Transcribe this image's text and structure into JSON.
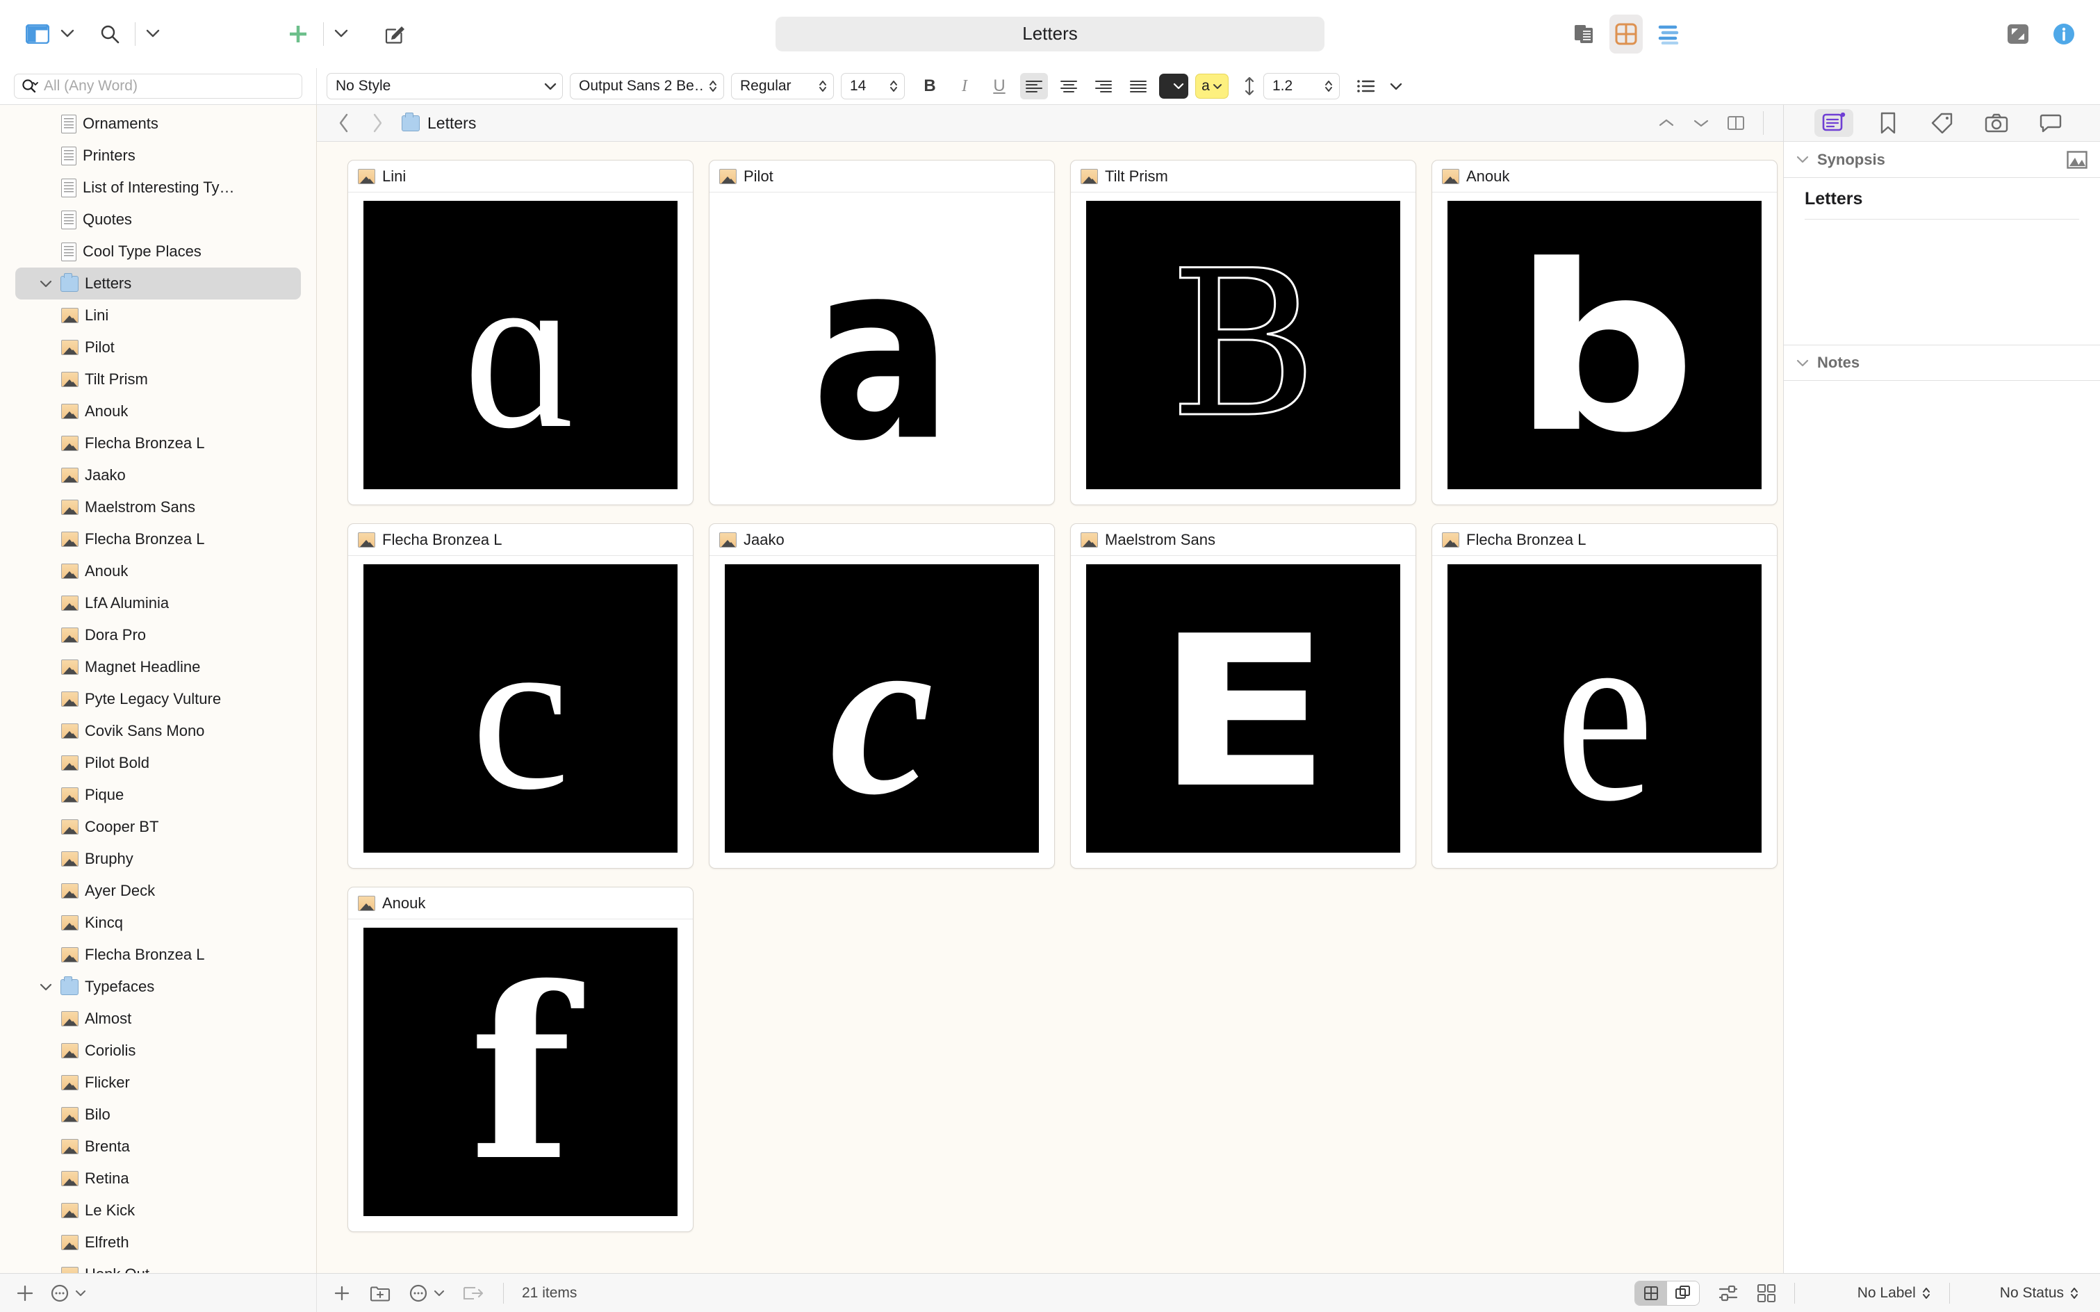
{
  "window": {
    "title": "Letters"
  },
  "toolbar": {
    "view_toggle": "sidebar-toggle",
    "search": "search",
    "add": "add",
    "compose": "compose",
    "copyholder": "copyholder",
    "corkboard": "corkboard",
    "outliner": "outliner",
    "composition_mode": "composition-mode",
    "inspector_toggle": "inspector"
  },
  "search": {
    "placeholder": "All (Any Word)"
  },
  "format_bar": {
    "style": "No Style",
    "font": "Output Sans 2 Be…",
    "weight": "Regular",
    "size": "14",
    "bold": "B",
    "italic": "I",
    "underline": "U",
    "text_color": "#2b2b2b",
    "highlight_color": "#fdf07f",
    "highlight_label": "a",
    "line_spacing": "1.2"
  },
  "binder": {
    "items": [
      {
        "label": "Ornaments",
        "icon": "document-icon",
        "indent": 1,
        "type": "doc"
      },
      {
        "label": "Printers",
        "icon": "document-icon",
        "indent": 1,
        "type": "doc"
      },
      {
        "label": "List of Interesting Ty…",
        "icon": "document-icon",
        "indent": 1,
        "type": "doc"
      },
      {
        "label": "Quotes",
        "icon": "document-icon",
        "indent": 1,
        "type": "doc"
      },
      {
        "label": "Cool Type Places",
        "icon": "document-icon",
        "indent": 1,
        "type": "doc"
      },
      {
        "label": "Letters",
        "icon": "folder-icon",
        "indent": 0,
        "type": "folder",
        "selected": true,
        "expanded": true
      },
      {
        "label": "Lini",
        "icon": "image-icon",
        "indent": 1,
        "type": "image"
      },
      {
        "label": "Pilot",
        "icon": "image-icon",
        "indent": 1,
        "type": "image"
      },
      {
        "label": "Tilt Prism",
        "icon": "image-icon",
        "indent": 1,
        "type": "image"
      },
      {
        "label": "Anouk",
        "icon": "image-icon",
        "indent": 1,
        "type": "image"
      },
      {
        "label": "Flecha Bronzea L",
        "icon": "image-icon",
        "indent": 1,
        "type": "image"
      },
      {
        "label": "Jaako",
        "icon": "image-icon",
        "indent": 1,
        "type": "image"
      },
      {
        "label": "Maelstrom Sans",
        "icon": "image-icon",
        "indent": 1,
        "type": "image"
      },
      {
        "label": "Flecha Bronzea L",
        "icon": "image-icon",
        "indent": 1,
        "type": "image"
      },
      {
        "label": "Anouk",
        "icon": "image-icon",
        "indent": 1,
        "type": "image"
      },
      {
        "label": "LfA Aluminia",
        "icon": "image-icon",
        "indent": 1,
        "type": "image"
      },
      {
        "label": "Dora Pro",
        "icon": "image-icon",
        "indent": 1,
        "type": "image"
      },
      {
        "label": "Magnet Headline",
        "icon": "image-icon",
        "indent": 1,
        "type": "image"
      },
      {
        "label": "Pyte Legacy Vulture",
        "icon": "image-icon",
        "indent": 1,
        "type": "image"
      },
      {
        "label": "Covik Sans Mono",
        "icon": "image-icon",
        "indent": 1,
        "type": "image"
      },
      {
        "label": "Pilot Bold",
        "icon": "image-icon",
        "indent": 1,
        "type": "image"
      },
      {
        "label": "Pique",
        "icon": "image-icon",
        "indent": 1,
        "type": "image"
      },
      {
        "label": "Cooper BT",
        "icon": "image-icon",
        "indent": 1,
        "type": "image"
      },
      {
        "label": "Bruphy",
        "icon": "image-icon",
        "indent": 1,
        "type": "image"
      },
      {
        "label": "Ayer Deck",
        "icon": "image-icon",
        "indent": 1,
        "type": "image"
      },
      {
        "label": "Kincq",
        "icon": "image-icon",
        "indent": 1,
        "type": "image"
      },
      {
        "label": "Flecha Bronzea L",
        "icon": "image-icon",
        "indent": 1,
        "type": "image"
      },
      {
        "label": "Typefaces",
        "icon": "folder-icon",
        "indent": 0,
        "type": "folder",
        "expanded": true
      },
      {
        "label": "Almost",
        "icon": "image-icon",
        "indent": 1,
        "type": "image"
      },
      {
        "label": "Coriolis",
        "icon": "image-icon",
        "indent": 1,
        "type": "image"
      },
      {
        "label": "Flicker",
        "icon": "image-icon",
        "indent": 1,
        "type": "image"
      },
      {
        "label": "Bilo",
        "icon": "image-icon",
        "indent": 1,
        "type": "image"
      },
      {
        "label": "Brenta",
        "icon": "image-icon",
        "indent": 1,
        "type": "image"
      },
      {
        "label": "Retina",
        "icon": "image-icon",
        "indent": 1,
        "type": "image"
      },
      {
        "label": "Le Kick",
        "icon": "image-icon",
        "indent": 1,
        "type": "image"
      },
      {
        "label": "Elfreth",
        "icon": "image-icon",
        "indent": 1,
        "type": "image"
      },
      {
        "label": "Henk Out",
        "icon": "image-icon",
        "indent": 1,
        "type": "image"
      }
    ]
  },
  "editor": {
    "breadcrumb_title": "Letters",
    "breadcrumb_icon": "folder-icon",
    "cards": [
      {
        "title": "Lini",
        "glyph": "ɑ",
        "style": "lini",
        "bg": "#000000",
        "fg": "#ffffff"
      },
      {
        "title": "Pilot",
        "glyph": "a",
        "style": "pilot",
        "bg": "#ffffff",
        "fg": "#000000"
      },
      {
        "title": "Tilt Prism",
        "glyph": "B",
        "style": "prism",
        "bg": "#000000",
        "fg": "#ffffff"
      },
      {
        "title": "Anouk",
        "glyph": "b",
        "style": "anouk",
        "bg": "#000000",
        "fg": "#ffffff"
      },
      {
        "title": "Flecha Bronzea L",
        "glyph": "c",
        "style": "flecha",
        "bg": "#000000",
        "fg": "#ffffff"
      },
      {
        "title": "Jaako",
        "glyph": "c",
        "style": "jaako",
        "bg": "#000000",
        "fg": "#ffffff"
      },
      {
        "title": "Maelstrom Sans",
        "glyph": "E",
        "style": "maelstrom",
        "bg": "#000000",
        "fg": "#ffffff"
      },
      {
        "title": "Flecha Bronzea L",
        "glyph": "e",
        "style": "flechae",
        "bg": "#000000",
        "fg": "#ffffff"
      },
      {
        "title": "Anouk",
        "glyph": "f",
        "style": "anoukf",
        "bg": "#000000",
        "fg": "#ffffff"
      }
    ]
  },
  "inspector": {
    "tabs": [
      {
        "name": "notes-tab",
        "icon": "note-card-icon",
        "selected": true
      },
      {
        "name": "bookmarks-tab",
        "icon": "bookmark-icon",
        "selected": false
      },
      {
        "name": "metadata-tab",
        "icon": "tag-icon",
        "selected": false
      },
      {
        "name": "snapshots-tab",
        "icon": "camera-icon",
        "selected": false
      },
      {
        "name": "comments-tab",
        "icon": "comment-icon",
        "selected": false
      }
    ],
    "synopsis_label": "Synopsis",
    "synopsis_title": "Letters",
    "notes_label": "Notes"
  },
  "footer": {
    "item_count": "21 items",
    "label": "No Label",
    "status": "No Status"
  }
}
